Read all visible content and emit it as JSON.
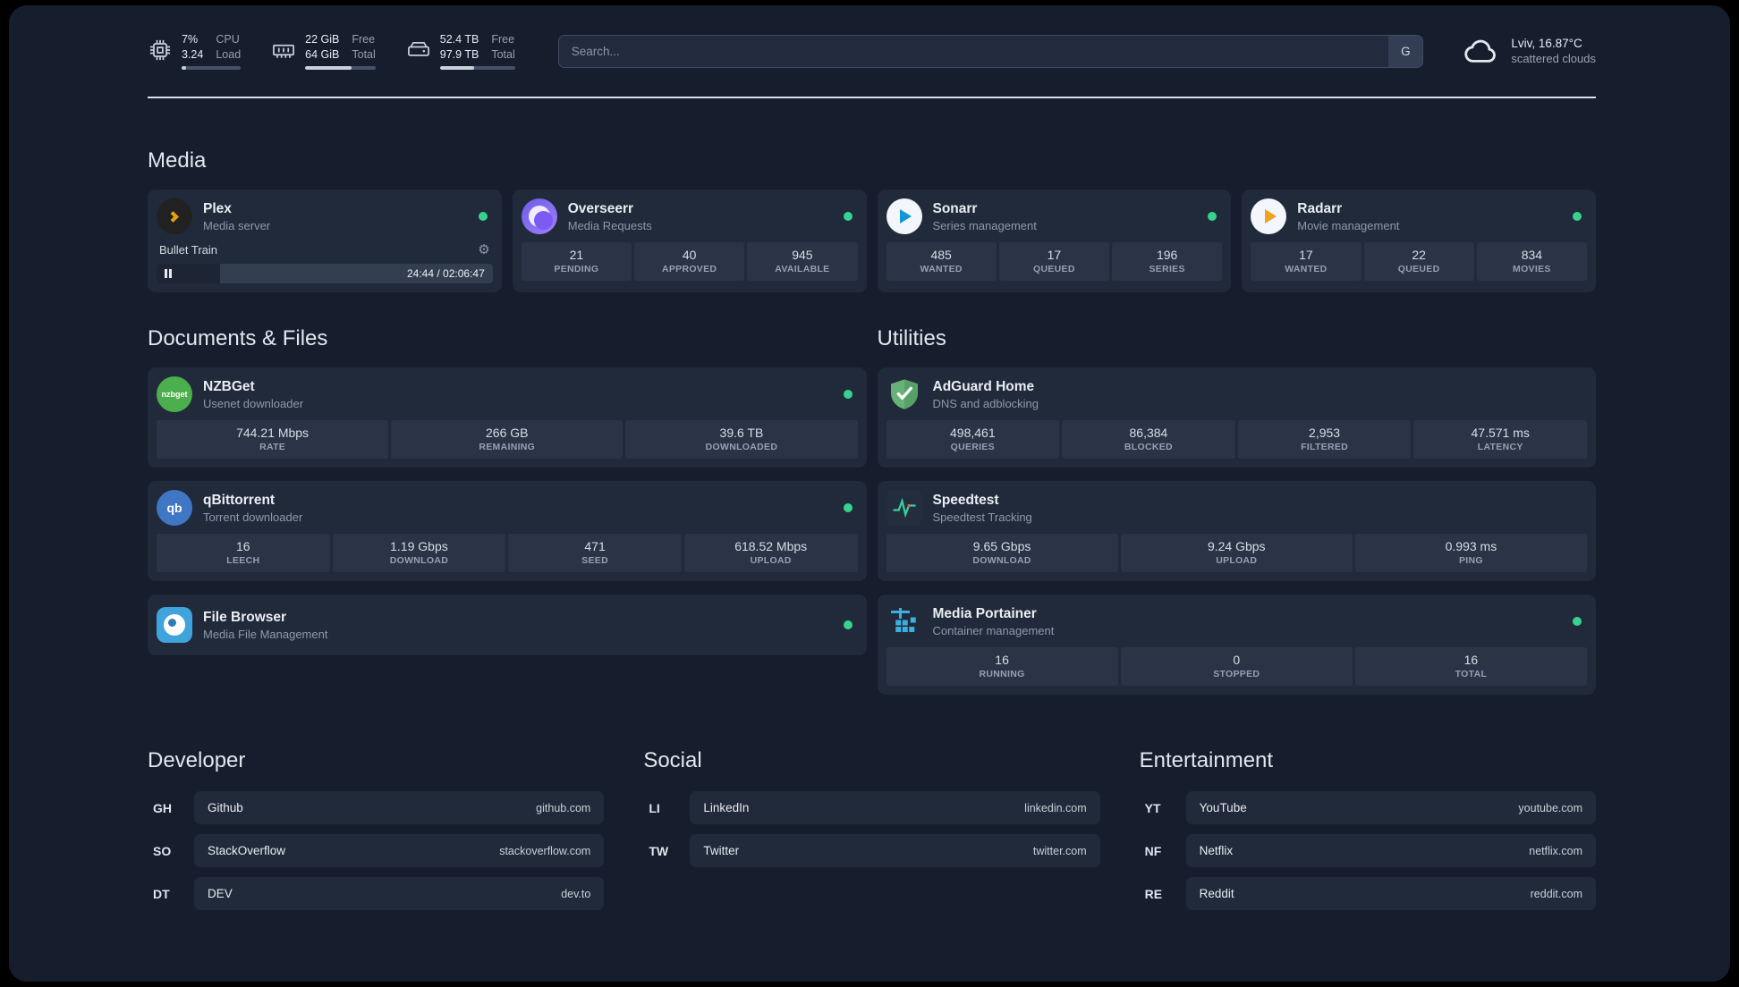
{
  "topbar": {
    "cpu": {
      "value1": "7%",
      "value2": "3.24",
      "label1": "CPU",
      "label2": "Load",
      "progress": 7
    },
    "memory": {
      "value1": "22 GiB",
      "value2": "64 GiB",
      "label1": "Free",
      "label2": "Total",
      "progress": 66
    },
    "disk": {
      "value1": "52.4 TB",
      "value2": "97.9 TB",
      "label1": "Free",
      "label2": "Total",
      "progress": 46
    },
    "search": {
      "placeholder": "Search...",
      "provider_button": "G"
    },
    "weather": {
      "location": "Lviv, 16.87°C",
      "condition": "scattered clouds"
    }
  },
  "sections": {
    "media": {
      "title": "Media",
      "cards": [
        {
          "name": "Plex",
          "subtitle": "Media server",
          "status": "online",
          "now_playing": {
            "title": "Bullet Train",
            "time": "24:44 / 02:06:47",
            "progress": 19
          }
        },
        {
          "name": "Overseerr",
          "subtitle": "Media Requests",
          "status": "online",
          "stats": [
            {
              "value": "21",
              "label": "PENDING"
            },
            {
              "value": "40",
              "label": "APPROVED"
            },
            {
              "value": "945",
              "label": "AVAILABLE"
            }
          ]
        },
        {
          "name": "Sonarr",
          "subtitle": "Series management",
          "status": "online",
          "stats": [
            {
              "value": "485",
              "label": "WANTED"
            },
            {
              "value": "17",
              "label": "QUEUED"
            },
            {
              "value": "196",
              "label": "SERIES"
            }
          ]
        },
        {
          "name": "Radarr",
          "subtitle": "Movie management",
          "status": "online",
          "stats": [
            {
              "value": "17",
              "label": "WANTED"
            },
            {
              "value": "22",
              "label": "QUEUED"
            },
            {
              "value": "834",
              "label": "MOVIES"
            }
          ]
        }
      ]
    },
    "documents": {
      "title": "Documents & Files",
      "cards": [
        {
          "name": "NZBGet",
          "subtitle": "Usenet downloader",
          "status": "online",
          "stats": [
            {
              "value": "744.21 Mbps",
              "label": "RATE"
            },
            {
              "value": "266 GB",
              "label": "REMAINING"
            },
            {
              "value": "39.6 TB",
              "label": "DOWNLOADED"
            }
          ]
        },
        {
          "name": "qBittorrent",
          "subtitle": "Torrent downloader",
          "status": "online",
          "stats": [
            {
              "value": "16",
              "label": "LEECH"
            },
            {
              "value": "1.19 Gbps",
              "label": "DOWNLOAD"
            },
            {
              "value": "471",
              "label": "SEED"
            },
            {
              "value": "618.52 Mbps",
              "label": "UPLOAD"
            }
          ]
        },
        {
          "name": "File Browser",
          "subtitle": "Media File Management",
          "status": "online",
          "stats": []
        }
      ]
    },
    "utilities": {
      "title": "Utilities",
      "cards": [
        {
          "name": "AdGuard Home",
          "subtitle": "DNS and adblocking",
          "stats": [
            {
              "value": "498,461",
              "label": "QUERIES"
            },
            {
              "value": "86,384",
              "label": "BLOCKED"
            },
            {
              "value": "2,953",
              "label": "FILTERED"
            },
            {
              "value": "47.571 ms",
              "label": "LATENCY"
            }
          ]
        },
        {
          "name": "Speedtest",
          "subtitle": "Speedtest Tracking",
          "stats": [
            {
              "value": "9.65 Gbps",
              "label": "DOWNLOAD"
            },
            {
              "value": "9.24 Gbps",
              "label": "UPLOAD"
            },
            {
              "value": "0.993 ms",
              "label": "PING"
            }
          ]
        },
        {
          "name": "Media Portainer",
          "subtitle": "Container management",
          "status": "online",
          "stats": [
            {
              "value": "16",
              "label": "RUNNING"
            },
            {
              "value": "0",
              "label": "STOPPED"
            },
            {
              "value": "16",
              "label": "TOTAL"
            }
          ]
        }
      ]
    }
  },
  "bookmarks": {
    "groups": [
      {
        "title": "Developer",
        "items": [
          {
            "abbr": "GH",
            "name": "Github",
            "url": "github.com"
          },
          {
            "abbr": "SO",
            "name": "StackOverflow",
            "url": "stackoverflow.com"
          },
          {
            "abbr": "DT",
            "name": "DEV",
            "url": "dev.to"
          }
        ]
      },
      {
        "title": "Social",
        "items": [
          {
            "abbr": "LI",
            "name": "LinkedIn",
            "url": "linkedin.com"
          },
          {
            "abbr": "TW",
            "name": "Twitter",
            "url": "twitter.com"
          }
        ]
      },
      {
        "title": "Entertainment",
        "items": [
          {
            "abbr": "YT",
            "name": "YouTube",
            "url": "youtube.com"
          },
          {
            "abbr": "NF",
            "name": "Netflix",
            "url": "netflix.com"
          },
          {
            "abbr": "RE",
            "name": "Reddit",
            "url": "reddit.com"
          }
        ]
      }
    ]
  },
  "glyphs": {
    "gear": "⚙",
    "qbittorrent_label": "qb",
    "nzbget_label": "nzbget"
  },
  "colors": {
    "panel_bg": "#161d2c",
    "card_bg": "#212a3a",
    "stat_bg": "#2b3446",
    "status_green": "#36d38e",
    "plex_gold": "#e5a00d"
  }
}
